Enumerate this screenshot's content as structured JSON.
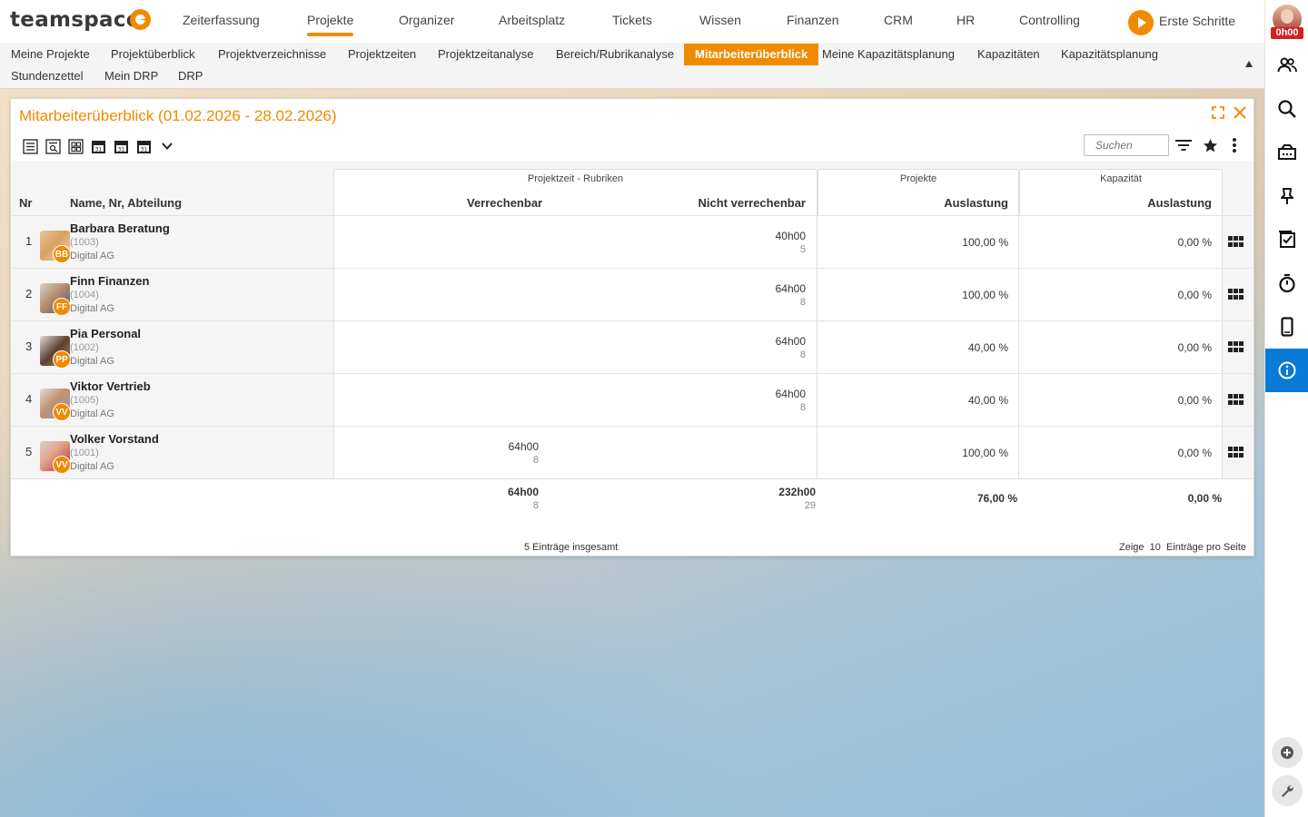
{
  "app": {
    "logo_text": "teamspace",
    "nav": [
      "Zeiterfassung",
      "Projekte",
      "Organizer",
      "Arbeitsplatz",
      "Tickets",
      "Wissen",
      "Finanzen",
      "CRM",
      "HR",
      "Controlling"
    ],
    "first_steps_label": "Erste Schritte",
    "time_badge": "0h00",
    "accent_color": "#f08a00",
    "active_rail_color": "#0a7ad6"
  },
  "subnav": {
    "row1": [
      "Meine Projekte",
      "Projektüberblick",
      "Projektverzeichnisse",
      "Projektzeiten",
      "Projektzeitanalyse",
      "Bereich/Rubrikanalyse",
      "Mitarbeiterüberblick",
      "Meine Kapazitätsplanung",
      "Kapazitäten",
      "Kapazitätsplanung"
    ],
    "row2": [
      "Stundenzettel",
      "Mein DRP",
      "DRP"
    ]
  },
  "window": {
    "title": "Mitarbeiterüberblick (01.02.2026 - 28.02.2026)",
    "search_placeholder": "Suchen"
  },
  "table": {
    "group_labels": {
      "projektzeit": "Projektzeit - Rubriken",
      "projekte": "Projekte",
      "kapazitaet": "Kapazität"
    },
    "headers": {
      "nr": "Nr",
      "name": "Name, Nr, Abteilung",
      "verrechenbar": "Verrechenbar",
      "nicht_verrechenbar": "Nicht verrechenbar",
      "auslastung_projekte": "Auslastung",
      "auslastung_kapazitaet": "Auslastung"
    },
    "rows": [
      {
        "nr": "1",
        "name": "Barbara Beratung",
        "id": "(1003)",
        "dept": "Digital AG",
        "initials": "BB",
        "verr": "",
        "verr_count": "",
        "nicht": "40h00",
        "nicht_count": "5",
        "proj": "100,00 %",
        "kap": "0,00 %"
      },
      {
        "nr": "2",
        "name": "Finn Finanzen",
        "id": "(1004)",
        "dept": "Digital AG",
        "initials": "FF",
        "verr": "",
        "verr_count": "",
        "nicht": "64h00",
        "nicht_count": "8",
        "proj": "100,00 %",
        "kap": "0,00 %"
      },
      {
        "nr": "3",
        "name": "Pia Personal",
        "id": "(1002)",
        "dept": "Digital AG",
        "initials": "PP",
        "verr": "",
        "verr_count": "",
        "nicht": "64h00",
        "nicht_count": "8",
        "proj": "40,00 %",
        "kap": "0,00 %"
      },
      {
        "nr": "4",
        "name": "Viktor Vertrieb",
        "id": "(1005)",
        "dept": "Digital AG",
        "initials": "VV",
        "verr": "",
        "verr_count": "",
        "nicht": "64h00",
        "nicht_count": "8",
        "proj": "40,00 %",
        "kap": "0,00 %"
      },
      {
        "nr": "5",
        "name": "Volker Vorstand",
        "id": "(1001)",
        "dept": "Digital AG",
        "initials": "VV",
        "verr": "64h00",
        "verr_count": "8",
        "nicht": "",
        "nicht_count": "",
        "proj": "100,00 %",
        "kap": "0,00 %"
      }
    ],
    "totals": {
      "verr": "64h00",
      "verr_count": "8",
      "nicht": "232h00",
      "nicht_count": "29",
      "proj": "76,00 %",
      "kap": "0,00 %"
    }
  },
  "footer": {
    "total_entries": "5 Einträge insgesamt",
    "page_prefix": "Zeige",
    "page_size": "10",
    "page_suffix": "Einträge pro Seite"
  }
}
